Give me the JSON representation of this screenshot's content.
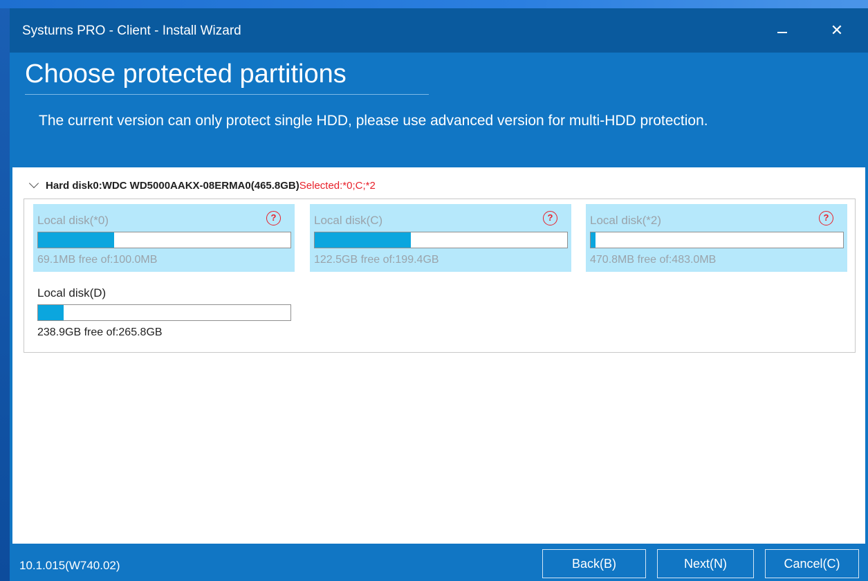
{
  "window": {
    "title": "Systurns PRO - Client  -  Install Wizard",
    "close_glyph": "✕"
  },
  "header": {
    "headline": "Choose protected partitions",
    "subtitle": "The current version can only protect single HDD, please use advanced version for multi-HDD protection."
  },
  "disk": {
    "name": "Hard disk0:WDC WD5000AAKX-08ERMA0(465.8GB)",
    "selected_text": "Selected:*0;C;*2",
    "partitions": [
      {
        "name": "Local disk(*0)",
        "info": "69.1MB free of:100.0MB",
        "selected": true,
        "used_fraction": 0.3
      },
      {
        "name": "Local disk(C)",
        "info": "122.5GB free of:199.4GB",
        "selected": true,
        "used_fraction": 0.38
      },
      {
        "name": "Local disk(*2)",
        "info": "470.8MB free of:483.0MB",
        "selected": true,
        "used_fraction": 0.02
      },
      {
        "name": "Local disk(D)",
        "info": "238.9GB free of:265.8GB",
        "selected": false,
        "used_fraction": 0.1
      }
    ]
  },
  "footer": {
    "version": "10.1.015(W740.02)",
    "back_label": "Back(B)",
    "next_label": "Next(N)",
    "cancel_label": "Cancel(C)"
  },
  "colors": {
    "window_bg": "#1176c4",
    "titlebar_bg": "#0a5a9e",
    "selected_partition_bg": "#b6e8fb",
    "bar_fill": "#0ba6de",
    "selected_text": "#e8202a"
  },
  "icons": {
    "help": "question-circle-icon",
    "expand": "chevron-down-icon",
    "minimize": "minimize-icon",
    "close": "close-icon"
  }
}
